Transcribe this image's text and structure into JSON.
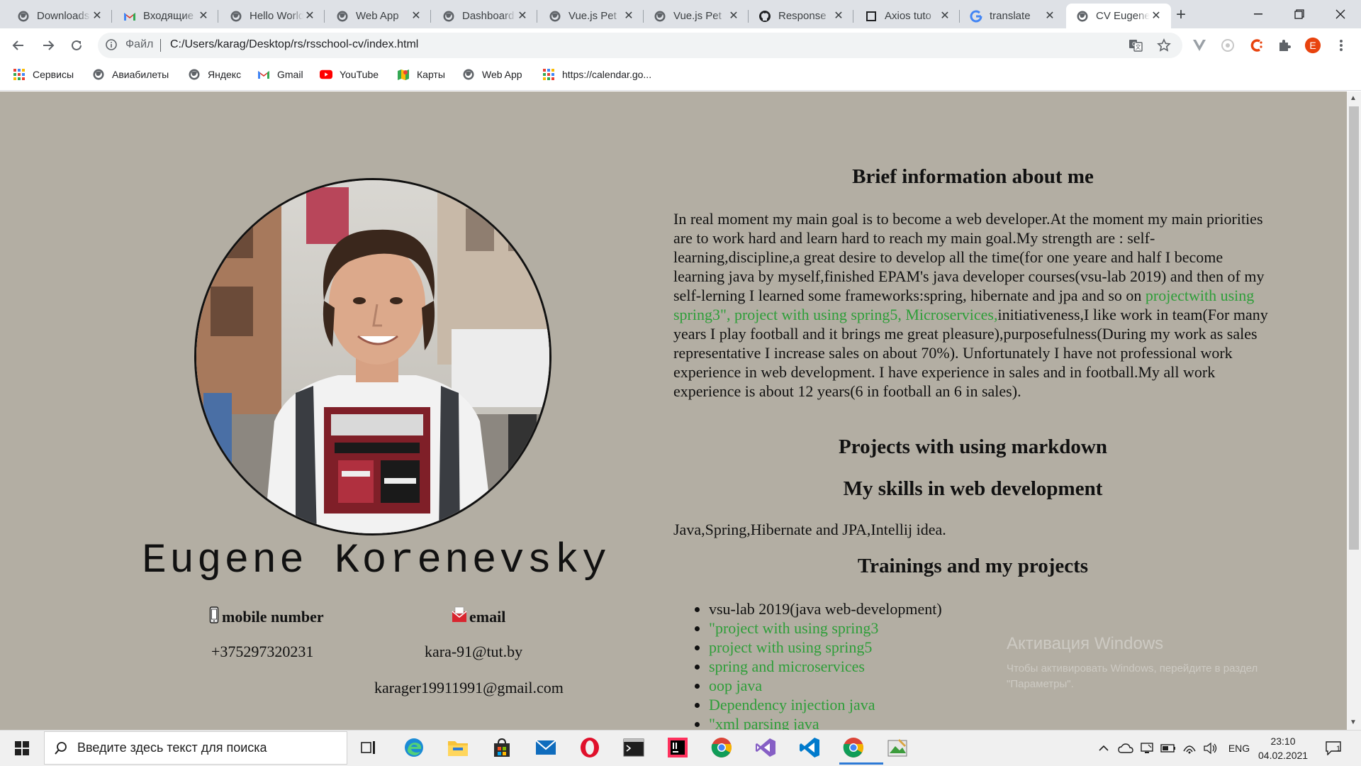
{
  "browser": {
    "tabs": [
      {
        "title": "Downloads",
        "icon": "globe-icon"
      },
      {
        "title": "Входящие",
        "icon": "gmail-icon"
      },
      {
        "title": "Hello World",
        "icon": "globe-icon"
      },
      {
        "title": "Web App",
        "icon": "globe-icon"
      },
      {
        "title": "Dashboard",
        "icon": "globe-icon"
      },
      {
        "title": "Vue.js Pet",
        "icon": "globe-icon"
      },
      {
        "title": "Vue.js Pet",
        "icon": "globe-icon"
      },
      {
        "title": "Response",
        "icon": "github-icon"
      },
      {
        "title": "Axios tuto",
        "icon": "square-icon"
      },
      {
        "title": "translate",
        "icon": "google-icon"
      },
      {
        "title": "CV Eugene",
        "icon": "globe-icon",
        "active": true
      }
    ],
    "address": {
      "scheme": "Файл",
      "url": "C:/Users/karag/Desktop/rs/rsschool-cv/index.html"
    },
    "profile_initial": "E",
    "bookmarks": [
      {
        "label": "Сервисы",
        "icon": "apps-grid-icon"
      },
      {
        "label": "Авиабилеты",
        "icon": "globe-icon"
      },
      {
        "label": "Яндекс",
        "icon": "globe-icon"
      },
      {
        "label": "Gmail",
        "icon": "gmail-icon"
      },
      {
        "label": "YouTube",
        "icon": "youtube-icon"
      },
      {
        "label": "Карты",
        "icon": "maps-icon"
      },
      {
        "label": "Web App",
        "icon": "globe-icon"
      },
      {
        "label": "https://calendar.go...",
        "icon": "apps-grid-icon"
      }
    ]
  },
  "cv": {
    "name": "Eugene Korenevsky",
    "contacts": {
      "mobile_label": "mobile number",
      "mobile_value": "+375297320231",
      "email_label": "email",
      "email_value_1": "kara-91@tut.by",
      "email_value_2": "karager19911991@gmail.com"
    },
    "brief_title": "Brief information about me",
    "brief_text_1": "In real moment my main goal is to become a web developer.At the moment my main priorities are to work hard and learn hard to reach my main goal.My strength are : self-learning,discipline,a great desire to develop all the time(for one yeare and half I become learning java by myself,finished EPAM's java developer courses(vsu-lab 2019) and then of my self-lerning I learned some frameworks:spring, hibernate and jpa and so on ",
    "brief_links": "projectwith using spring3\", project with using spring5, Microservices,",
    "brief_text_2": "initiativeness,I like work in team(For many years I play football and it brings me great pleasure),purposefulness(During my work as sales representative I increase sales on about 70%). Unfortunately I have not professional work experience in web development. I have experience in sales and in football.My all work experience is about 12 years(6 in football an 6 in sales).",
    "markdown_title": "Projects with using markdown",
    "skills_title": "My skills in web development",
    "skills_text": "Java,Spring,Hibernate and JPA,Intellij idea.",
    "trainings_title": "Trainings and my projects",
    "trainings": [
      {
        "text": "vsu-lab 2019(java web-development)",
        "link": false
      },
      {
        "text": "\"project with using spring3",
        "link": true
      },
      {
        "text": "project with using spring5",
        "link": true
      },
      {
        "text": "spring and microservices",
        "link": true
      },
      {
        "text": "oop java",
        "link": true
      },
      {
        "text": "Dependency injection java",
        "link": true
      },
      {
        "text": "\"xml parsing java",
        "link": true
      }
    ],
    "link_color": "#2e9e39",
    "page_bg": "#b3aea3"
  },
  "watermark": {
    "title": "Активация Windows",
    "line1": "Чтобы активировать Windows, перейдите в раздел",
    "line2": "\"Параметры\"."
  },
  "taskbar": {
    "search_placeholder": "Введите здесь текст для поиска",
    "lang": "ENG",
    "time": "23:10",
    "date": "04.02.2021",
    "notifications": "1"
  }
}
